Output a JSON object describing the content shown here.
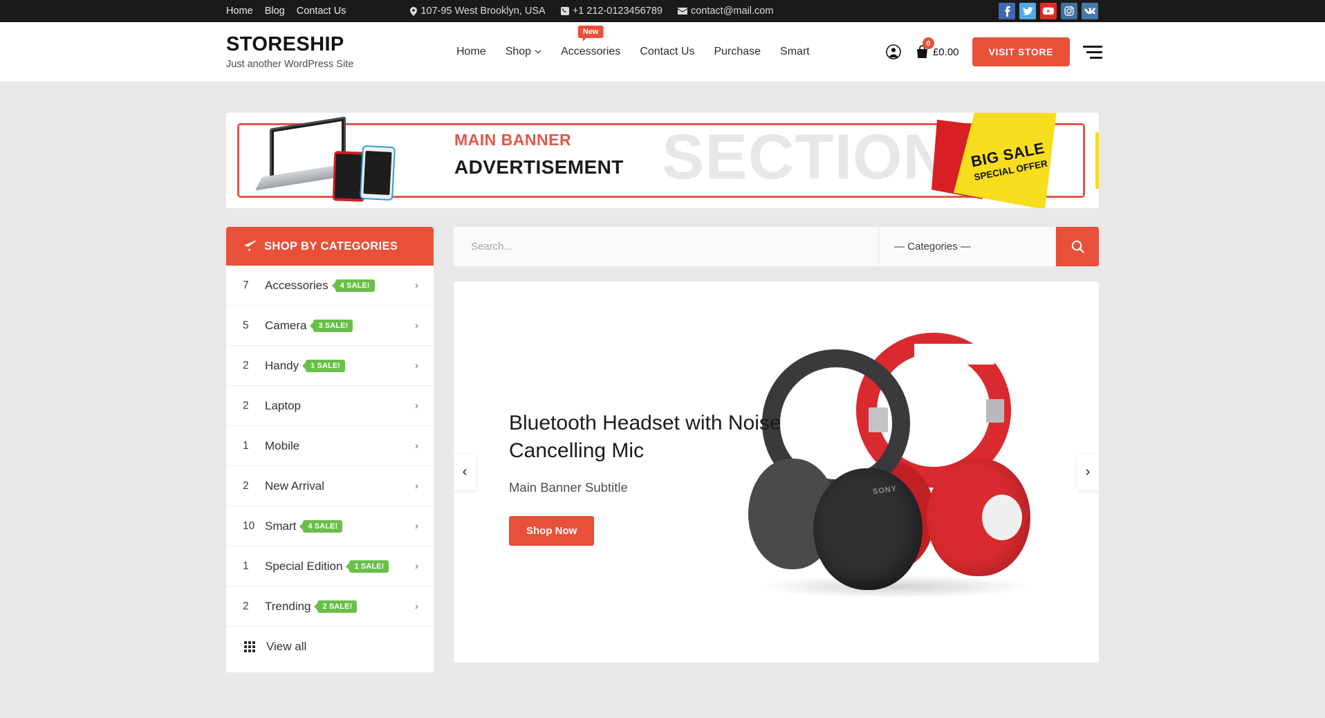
{
  "topbar": {
    "links": [
      {
        "label": "Home"
      },
      {
        "label": "Blog"
      },
      {
        "label": "Contact Us"
      }
    ],
    "address": "107-95 West Brooklyn, USA",
    "phone": "+1 212-0123456789",
    "email": "contact@mail.com",
    "socials": [
      {
        "name": "facebook",
        "title": "Facebook"
      },
      {
        "name": "twitter",
        "title": "Twitter"
      },
      {
        "name": "youtube",
        "title": "YouTube"
      },
      {
        "name": "instagram",
        "title": "Instagram"
      },
      {
        "name": "vk",
        "title": "VK"
      }
    ]
  },
  "header": {
    "brand_title": "STORESHIP",
    "brand_tagline": "Just another WordPress Site",
    "nav": [
      {
        "label": "Home",
        "has_caret": false,
        "badge": ""
      },
      {
        "label": "Shop",
        "has_caret": true,
        "badge": ""
      },
      {
        "label": "Accessories",
        "has_caret": false,
        "badge": "New"
      },
      {
        "label": "Contact Us",
        "has_caret": false,
        "badge": ""
      },
      {
        "label": "Purchase",
        "has_caret": false,
        "badge": ""
      },
      {
        "label": "Smart",
        "has_caret": false,
        "badge": ""
      }
    ],
    "cart_count": "0",
    "cart_total": "£0.00",
    "visit_store_label": "VISIT STORE"
  },
  "ad_banner": {
    "line1": "MAIN BANNER",
    "line2": "ADVERTISEMENT",
    "ghost_text": "SECTION",
    "sale_line1": "BIG SALE",
    "sale_line2": "SPECIAL OFFER"
  },
  "sidebar": {
    "heading": "SHOP BY CATEGORIES",
    "categories": [
      {
        "count": "7",
        "name": "Accessories",
        "badge": "4 SALE!"
      },
      {
        "count": "5",
        "name": "Camera",
        "badge": "3 SALE!"
      },
      {
        "count": "2",
        "name": "Handy",
        "badge": "1 SALE!"
      },
      {
        "count": "2",
        "name": "Laptop",
        "badge": ""
      },
      {
        "count": "1",
        "name": "Mobile",
        "badge": ""
      },
      {
        "count": "2",
        "name": "New Arrival",
        "badge": ""
      },
      {
        "count": "10",
        "name": "Smart",
        "badge": "4 SALE!"
      },
      {
        "count": "1",
        "name": "Special Edition",
        "badge": "1 SALE!"
      },
      {
        "count": "2",
        "name": "Trending",
        "badge": "2 SALE!"
      }
    ],
    "view_all_label": "View all"
  },
  "search": {
    "value": "",
    "placeholder": "Search...",
    "category_selected": "— Categories —"
  },
  "slider": {
    "title": "Bluetooth Headset with Noise Cancelling Mic",
    "subtitle": "Main Banner Subtitle",
    "cta_label": "Shop Now",
    "prev_label": "‹",
    "next_label": "›"
  },
  "colors": {
    "accent": "#e8503a",
    "sale_green": "#67C048",
    "topbar_bg": "#1a1a1a",
    "page_bg": "#e8e8e8"
  }
}
